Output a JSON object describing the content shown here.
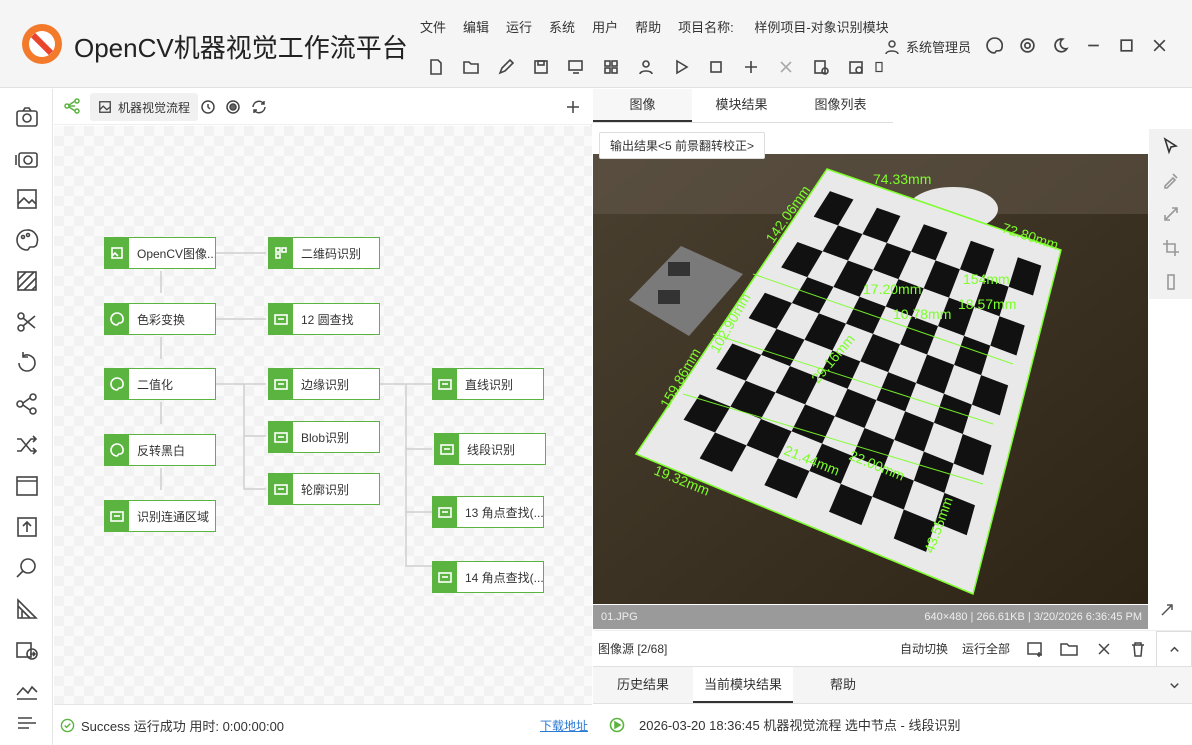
{
  "app": {
    "title": "OpenCV机器视觉工作流平台",
    "menu": [
      "文件",
      "编辑",
      "运行",
      "系统",
      "用户",
      "帮助"
    ],
    "project_label": "项目名称:",
    "project_name": "样例项目-对象识别模块",
    "user": "系统管理员"
  },
  "flow": {
    "tab_label": "机器视觉流程",
    "nodes": [
      "OpenCV图像...",
      "二维码识别",
      "色彩变换",
      "12 圆查找",
      "二值化",
      "边缘识别",
      "直线识别",
      "Blob识别",
      "线段识别",
      "反转黑白",
      "轮廓识别",
      "13 角点查找(...",
      "识别连通区域",
      "14 角点查找(..."
    ]
  },
  "status": {
    "text": "Success 运行成功 用时: 0:00:00:00",
    "download": "下载地址"
  },
  "viewer": {
    "tabs": [
      "图像",
      "模块结果",
      "图像列表"
    ],
    "output_tag": "输出结果<5 前景翻转校正>",
    "file": "01.JPG",
    "info": "640×480 | 266.61KB | 3/20/2026 6:36:45 PM",
    "source": "图像源 [2/68]",
    "auto_switch": "自动切换",
    "run_all": "运行全部",
    "measure_labels": [
      "74.33mm",
      "72.80mm",
      "142.06mm",
      "102.90mm",
      "159.86mm",
      "17.20mm",
      "21.44mm",
      "22.00mm",
      "154mm",
      "18.57mm",
      "10.78mm",
      "29.16mm",
      "43.55mm",
      "19.32mm"
    ]
  },
  "bottom": {
    "tabs": [
      "历史结果",
      "当前模块结果",
      "帮助"
    ],
    "log": "2026-03-20 18:36:45  机器视觉流程 选中节点 - 线段识别"
  },
  "colors": {
    "accent": "#5bb440",
    "measure": "#7cff2a"
  }
}
